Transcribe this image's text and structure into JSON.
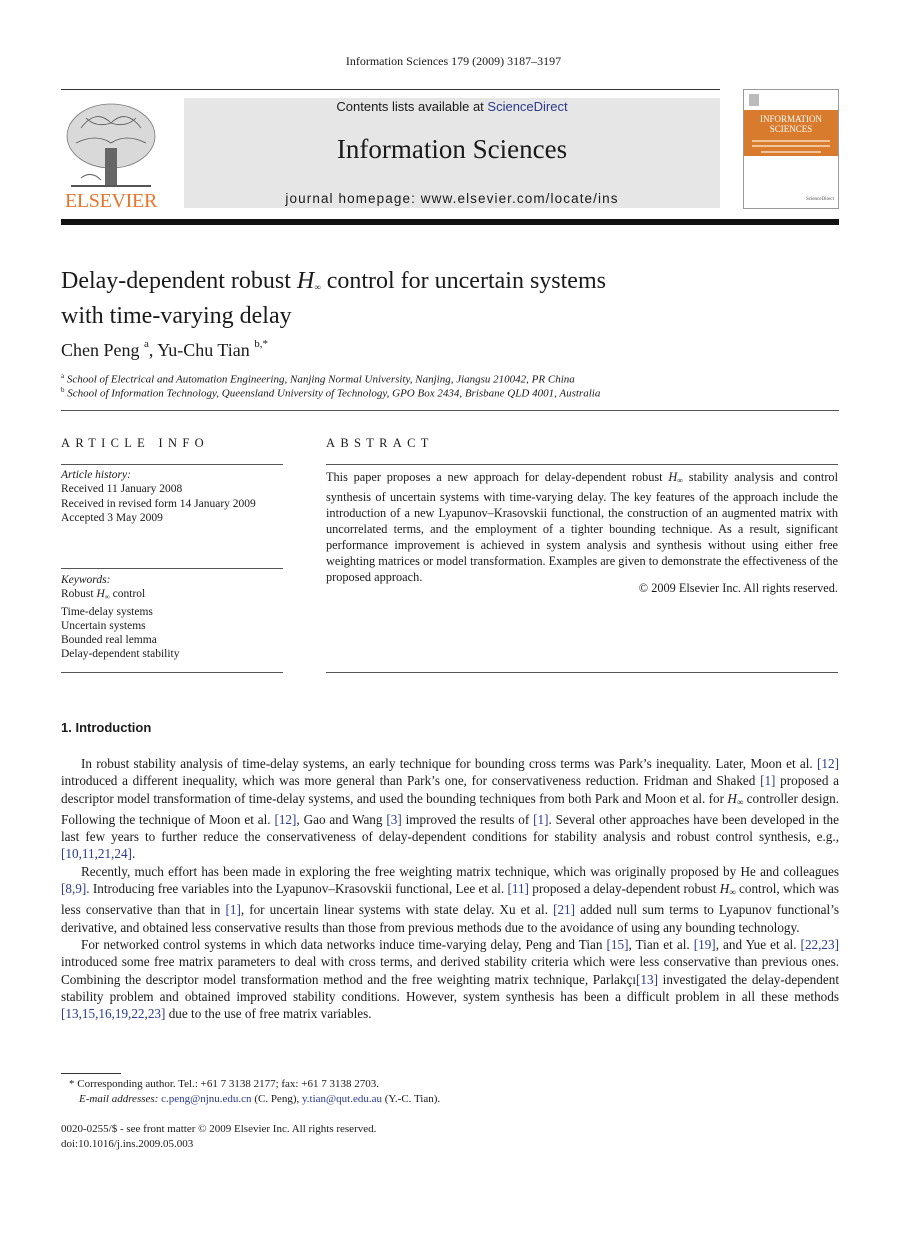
{
  "header": {
    "citation": "Information Sciences 179 (2009) 3187–3197",
    "publisher_logo_text": "ELSEVIER",
    "contents_prefix": "Contents lists available at ",
    "contents_link": "ScienceDirect",
    "journal_name": "Information Sciences",
    "homepage": "journal homepage: www.elsevier.com/locate/ins",
    "cover_title_line1": "INFORMATION",
    "cover_title_line2": "SCIENCES"
  },
  "article": {
    "title_part1": "Delay-dependent robust ",
    "title_math": "H",
    "title_sub": "∞",
    "title_part2": " control for uncertain systems",
    "title_line2": "with time-varying delay",
    "authors": [
      {
        "name": "Chen Peng",
        "sup": "a"
      },
      {
        "name": "Yu-Chu Tian",
        "sup": "b,*"
      }
    ],
    "author_separator": ", ",
    "affiliations": [
      {
        "sup": "a",
        "text": "School of Electrical and Automation Engineering, Nanjing Normal University, Nanjing, Jiangsu 210042, PR China"
      },
      {
        "sup": "b",
        "text": "School of Information Technology, Queensland University of Technology, GPO Box 2434, Brisbane QLD 4001, Australia"
      }
    ]
  },
  "article_info": {
    "label": "ARTICLE INFO",
    "history_heading": "Article history:",
    "history": [
      "Received 11 January 2008",
      "Received in revised form 14 January 2009",
      "Accepted 3 May 2009"
    ],
    "keywords_heading": "Keywords:",
    "keyword1_prefix": "Robust ",
    "keyword1_math": "H",
    "keyword1_sub": "∞",
    "keyword1_suffix": " control",
    "keywords_rest": [
      "Time-delay systems",
      "Uncertain systems",
      "Bounded real lemma",
      "Delay-dependent stability"
    ]
  },
  "abstract": {
    "label": "ABSTRACT",
    "text_part1": "This paper proposes a new approach for delay-dependent robust ",
    "text_math": "H",
    "text_sub": "∞",
    "text_part2": " stability analysis and control synthesis of uncertain systems with time-varying delay. The key features of the approach include the introduction of a new Lyapunov–Krasovskii functional, the construction of an augmented matrix with uncorrelated terms, and the employment of a tighter bounding technique. As a result, significant performance improvement is achieved in system analysis and synthesis without using either free weighting matrices or model transformation. Examples are given to demonstrate the effectiveness of the proposed approach.",
    "copyright": "© 2009 Elsevier Inc. All rights reserved."
  },
  "introduction": {
    "heading": "1.  Introduction",
    "p1": [
      {
        "t": "In robust stability analysis of time-delay systems, an early technique for bounding cross terms was Park’s inequality. Later, Moon et al. "
      },
      {
        "ref": "[12]"
      },
      {
        "t": " introduced a different inequality, which was more general than Park’s one, for conservativeness reduction. Fridman and Shaked "
      },
      {
        "ref": "[1]"
      },
      {
        "t": " proposed a descriptor model transformation of time-delay systems, and used the bounding techniques from both Park and Moon et al. for "
      },
      {
        "math": "H",
        "sub": "∞"
      },
      {
        "t": " controller design. Following the technique of Moon et al. "
      },
      {
        "ref": "[12]"
      },
      {
        "t": ", Gao and Wang "
      },
      {
        "ref": "[3]"
      },
      {
        "t": " improved the results of "
      },
      {
        "ref": "[1]"
      },
      {
        "t": ". Several other approaches have been developed in the last few years to further reduce the conservativeness of delay-dependent conditions for stability analysis and robust control synthesis, e.g., "
      },
      {
        "ref": "[10,11,21,24]"
      },
      {
        "t": "."
      }
    ],
    "p2": [
      {
        "t": "Recently, much effort has been made in exploring the free weighting matrix technique, which was originally proposed by He and colleagues "
      },
      {
        "ref": "[8,9]"
      },
      {
        "t": ". Introducing free variables into the Lyapunov–Krasovskii functional, Lee et al. "
      },
      {
        "ref": "[11]"
      },
      {
        "t": " proposed a delay-dependent robust "
      },
      {
        "math": "H",
        "sub": "∞"
      },
      {
        "t": " control, which was less conservative than that in "
      },
      {
        "ref": "[1]"
      },
      {
        "t": ", for uncertain linear systems with state delay. Xu et al. "
      },
      {
        "ref": "[21]"
      },
      {
        "t": " added null sum terms to Lyapunov functional’s derivative, and obtained less conservative results than those from previous methods due to the avoidance of using any bounding technology."
      }
    ],
    "p3": [
      {
        "t": "For networked control systems in which data networks induce time-varying delay, Peng and Tian "
      },
      {
        "ref": "[15]"
      },
      {
        "t": ", Tian et al. "
      },
      {
        "ref": "[19]"
      },
      {
        "t": ", and Yue et al. "
      },
      {
        "ref": "[22,23]"
      },
      {
        "t": " introduced some free matrix parameters to deal with cross terms, and derived stability criteria which were less conservative than previous ones. Combining the descriptor model transformation method and the free weighting matrix technique, Parlakçı"
      },
      {
        "ref": "[13]"
      },
      {
        "t": " investigated the delay-dependent stability problem and obtained improved stability conditions. However, system synthesis has been a difficult problem in all these methods "
      },
      {
        "ref": "[13,15,16,19,22,23]"
      },
      {
        "t": " due to the use of free matrix variables."
      }
    ]
  },
  "footnotes": {
    "corresponding": "*  Corresponding author. Tel.: +61 7 3138 2177; fax: +61 7 3138 2703.",
    "email_label": "E-mail addresses:",
    "email1": "c.peng@njnu.edu.cn",
    "email1_owner": " (C. Peng), ",
    "email2": "y.tian@qut.edu.au",
    "email2_owner": " (Y.-C. Tian).",
    "front_matter": "0020-0255/$ - see front matter © 2009 Elsevier Inc. All rights reserved.",
    "doi": "doi:10.1016/j.ins.2009.05.003"
  }
}
